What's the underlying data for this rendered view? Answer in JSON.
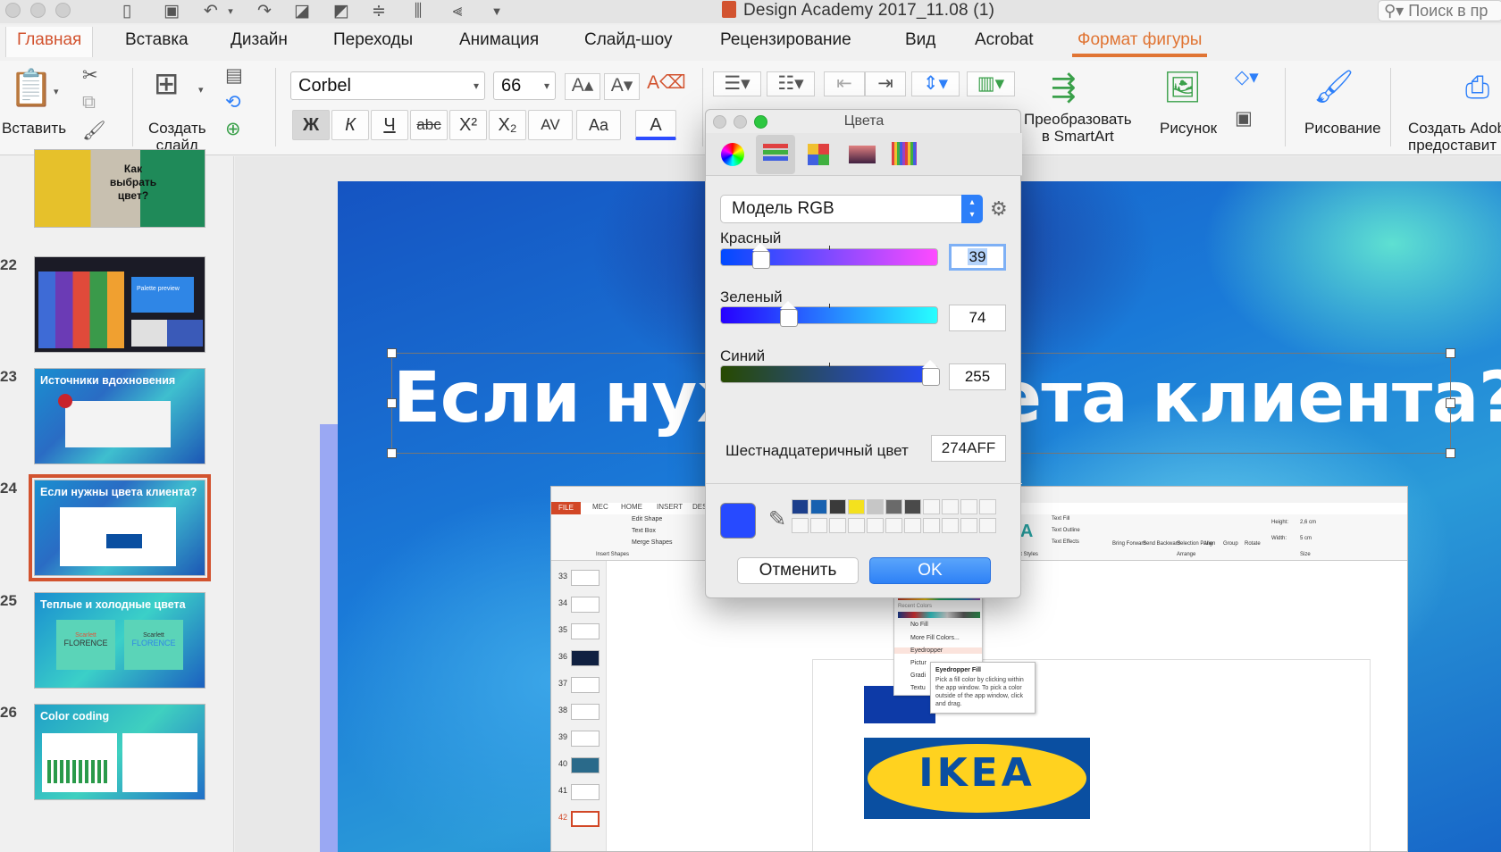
{
  "window": {
    "title": "Design Academy 2017_11.08 (1)",
    "search_placeholder": "Поиск в пр"
  },
  "tabs": [
    "Главная",
    "Вставка",
    "Дизайн",
    "Переходы",
    "Анимация",
    "Слайд-шоу",
    "Рецензирование",
    "Вид",
    "Acrobat",
    "Формат фигуры"
  ],
  "ribbon": {
    "paste_label": "Вставить",
    "new_slide_label": "Создать\nслайд",
    "font_name": "Corbel",
    "font_size": "66",
    "bold": "Ж",
    "italic": "К",
    "underline": "Ч",
    "strike": "abc",
    "superscript": "X²",
    "subscript": "X₂",
    "spacing": "AV",
    "change_case": "Aa",
    "font_color": "A",
    "smartart_label": "Преобразовать\nв SmartArt",
    "picture_label": "Рисунок",
    "drawing_label": "Рисование",
    "adobe_label": "Создать Adob\nпредоставит"
  },
  "slides": [
    {
      "num": "",
      "title": "Как выбрать цвет?"
    },
    {
      "num": "22",
      "title": "Palette preview"
    },
    {
      "num": "23",
      "title": "Источники вдохновения"
    },
    {
      "num": "24",
      "title": "Если нужны цвета клиента?",
      "selected": true
    },
    {
      "num": "25",
      "title": "Теплые и холодные цвета",
      "sub1": "FLORENCE",
      "sub2": "FLORENCE",
      "script1": "Scarlett",
      "script2": "Scarlett"
    },
    {
      "num": "26",
      "title": "Color coding"
    }
  ],
  "slide": {
    "title": "Если нужны цвета клиента?",
    "embedded": {
      "tabs": [
        "FILE",
        "МЕС",
        "HOME",
        "INSERT",
        "DESI"
      ],
      "thumb_nums": [
        "33",
        "34",
        "35",
        "36",
        "37",
        "38",
        "39",
        "40",
        "41",
        "42"
      ],
      "ribbon_items": [
        "Edit Shape",
        "Text Box",
        "Merge Shapes",
        "Insert Shapes",
        "Text Fill",
        "Text Outline",
        "Text Effects",
        "WordArt Styles",
        "Bring Forward",
        "Send Backward",
        "Selection Pane",
        "Align",
        "Group",
        "Rotate",
        "Arrange",
        "Height:",
        "2,6 cm",
        "Width:",
        "5 cm",
        "Size"
      ],
      "menu": [
        "Recent Colors",
        "No Fill",
        "More Fill Colors...",
        "Eyedropper",
        "Pictur",
        "Gradi",
        "Textu"
      ],
      "tooltip_title": "Eyedropper Fill",
      "tooltip_text": "Pick a fill color by clicking within the app window. To pick a color outside of the app window, click and drag.",
      "logo_text": "IKEA"
    }
  },
  "dialog": {
    "title": "Цвета",
    "model": "Модель RGB",
    "red_label": "Красный",
    "red": 39,
    "green_label": "Зеленый",
    "green": 74,
    "blue_label": "Синий",
    "blue": 255,
    "hex_label": "Шестнадцатеричный цвет",
    "hex": "274AFF",
    "swatch_color": "#274AFF",
    "saved_swatches": [
      "#1c3f8c",
      "#1761b0",
      "#3a3a3a",
      "#f4e11e",
      "#c6c6c6",
      "#6a6a6a",
      "#4a4a4a"
    ],
    "cancel_label": "Отменить",
    "ok_label": "OK"
  },
  "colors": {
    "accent": "#d2532f",
    "format_tab": "#e07433",
    "ok_blue": "#2e81f6"
  }
}
